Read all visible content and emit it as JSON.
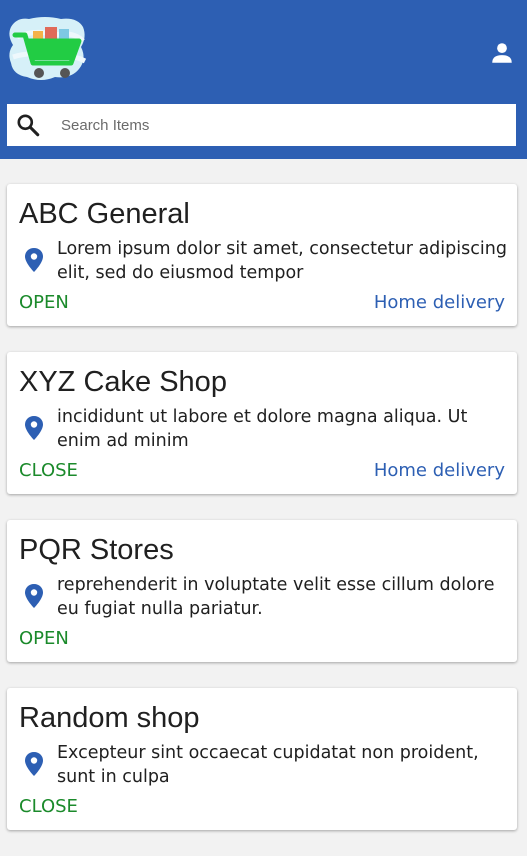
{
  "colors": {
    "header_bg": "#2d5fb3",
    "status_color": "#1b8a2b",
    "delivery_color": "#2d5fb3",
    "pin_color": "#2d5fb3",
    "cart_color": "#22cc44"
  },
  "header": {
    "logo_icon": "shopping-cart-icon",
    "account_icon": "person-icon"
  },
  "search": {
    "icon": "search-icon",
    "placeholder": "Search Items",
    "value": ""
  },
  "stores": [
    {
      "name": "ABC General",
      "address": "Lorem ipsum dolor sit amet, consectetur adipiscing elit, sed do eiusmod tempor",
      "status": "OPEN",
      "delivery": "Home delivery"
    },
    {
      "name": "XYZ Cake Shop",
      "address": "incididunt ut labore et dolore magna aliqua. Ut enim ad minim",
      "status": "CLOSE",
      "delivery": "Home delivery"
    },
    {
      "name": "PQR Stores",
      "address": "reprehenderit in voluptate velit esse cillum dolore eu fugiat nulla pariatur.",
      "status": "OPEN",
      "delivery": ""
    },
    {
      "name": "Random shop",
      "address": "Excepteur sint occaecat cupidatat non proident, sunt in culpa",
      "status": "CLOSE",
      "delivery": ""
    }
  ]
}
